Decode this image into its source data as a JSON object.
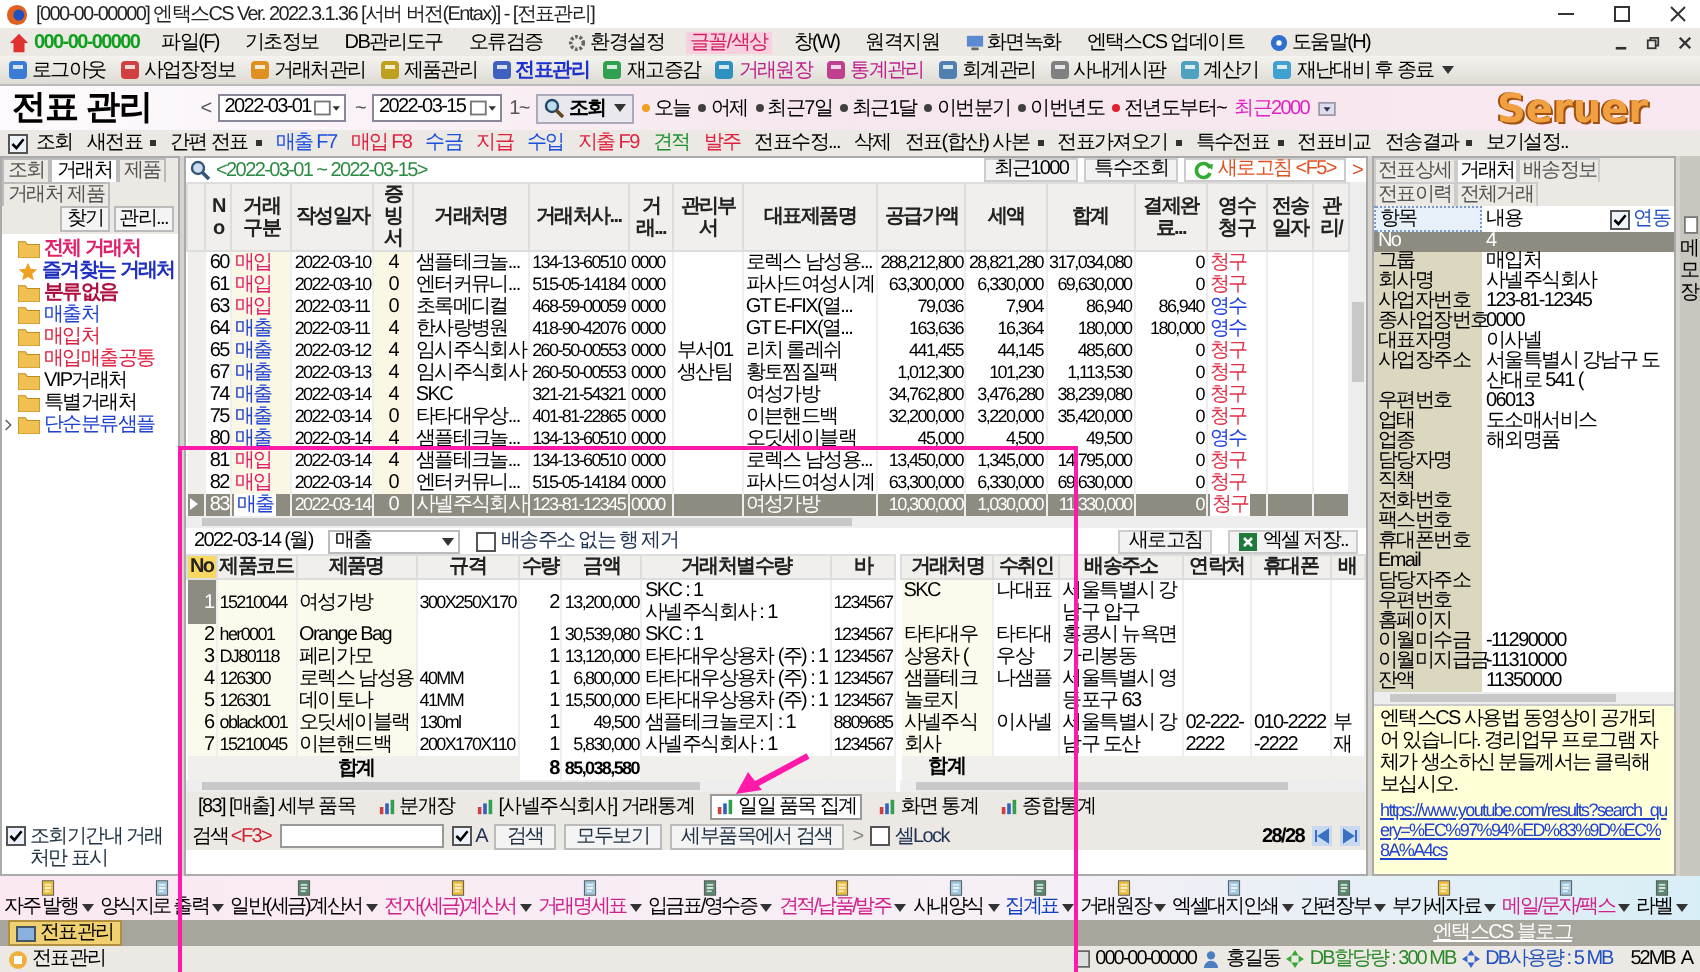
{
  "window": {
    "title": "[000-00-00000] 엔택스CS Ver. 2022.3.1.36 [서버 버전(Entax)] - [전표관리]"
  },
  "menu": {
    "company": "000-00-00000",
    "items": [
      {
        "label": "파일(F)",
        "highlighted": false
      },
      {
        "label": "기초정보",
        "highlighted": false
      },
      {
        "label": "DB관리도구",
        "highlighted": false
      },
      {
        "label": "오류검증",
        "highlighted": false
      },
      {
        "label": "환경설정",
        "highlighted": false
      },
      {
        "label": "글꼴/색상",
        "highlighted": true
      },
      {
        "label": "창(W)",
        "highlighted": false
      },
      {
        "label": "원격지원",
        "highlighted": false
      },
      {
        "label": "화면녹화",
        "highlighted": false
      },
      {
        "label": "엔택스CS 업데이트",
        "highlighted": false
      },
      {
        "label": "도움말(H)",
        "highlighted": false
      }
    ]
  },
  "toolbar": [
    {
      "label": "로그아웃",
      "color": "#000000",
      "selected": false,
      "dropdown": false
    },
    {
      "label": "사업장정보",
      "color": "#000000",
      "selected": false,
      "dropdown": false
    },
    {
      "label": "거래처관리",
      "color": "#000000",
      "selected": false,
      "dropdown": false
    },
    {
      "label": "제품관리",
      "color": "#000000",
      "selected": false,
      "dropdown": false
    },
    {
      "label": "전표관리",
      "color": "#1a2fd0",
      "selected": true,
      "dropdown": false
    },
    {
      "label": "재고증감",
      "color": "#000000",
      "selected": false,
      "dropdown": false
    },
    {
      "label": "거래원장",
      "color": "#c0208c",
      "selected": false,
      "dropdown": false
    },
    {
      "label": "통계관리",
      "color": "#c0208c",
      "selected": false,
      "dropdown": false
    },
    {
      "label": "회계관리",
      "color": "#000000",
      "selected": false,
      "dropdown": false
    },
    {
      "label": "사내게시판",
      "color": "#000000",
      "selected": false,
      "dropdown": false
    },
    {
      "label": "계산기",
      "color": "#000000",
      "selected": false,
      "dropdown": false
    },
    {
      "label": "재난대비 후 종료",
      "color": "#000000",
      "selected": false,
      "dropdown": true
    }
  ],
  "header": {
    "title": "전표 관리",
    "prev": "<",
    "date_from": "2022-03-01",
    "separator": "~",
    "date_to": "2022-03-15",
    "count": "1~",
    "search": "조회",
    "quick_ranges": [
      {
        "label": "오늘",
        "kind": "bullet",
        "color": "#f0a020"
      },
      {
        "label": "어제",
        "kind": "bullet",
        "color": "#404040"
      },
      {
        "label": "최근7일",
        "kind": "bullet",
        "color": "#404040"
      },
      {
        "label": "최근1달",
        "kind": "bullet",
        "color": "#404040"
      },
      {
        "label": "이번분기",
        "kind": "bullet",
        "color": "#404040"
      },
      {
        "label": "이번년도",
        "kind": "bullet",
        "color": "#404040"
      },
      {
        "label": "전년도부터~",
        "kind": "bullet",
        "color": "#e02030"
      },
      {
        "label": "최근2000",
        "kind": "highlight",
        "color": "#e020c0"
      }
    ],
    "logo": "Seruer"
  },
  "actions": {
    "view": {
      "label": "조회",
      "checked": true
    },
    "items": [
      {
        "label": "새전표",
        "color": "#000000",
        "dropdown": true
      },
      {
        "label": "간편 전표",
        "color": "#000000",
        "dropdown": true
      },
      {
        "label": "매출 F7",
        "color": "#1a4fe0",
        "dropdown": false
      },
      {
        "label": "매입 F8",
        "color": "#e02040",
        "dropdown": false
      },
      {
        "label": "수금",
        "color": "#1a4fe0",
        "dropdown": false
      },
      {
        "label": "지급",
        "color": "#e02040",
        "dropdown": false
      },
      {
        "label": "수입",
        "color": "#1a4fe0",
        "dropdown": false
      },
      {
        "label": "지출 F9",
        "color": "#e02040",
        "dropdown": false
      },
      {
        "label": "견적",
        "color": "#1a9030",
        "dropdown": false
      },
      {
        "label": "발주",
        "color": "#e02040",
        "dropdown": false
      },
      {
        "label": "전표수정...",
        "color": "#000000",
        "dropdown": false
      },
      {
        "label": "삭제",
        "color": "#000000",
        "dropdown": false
      },
      {
        "label": "전표(합산) 사본",
        "color": "#000000",
        "dropdown": true
      },
      {
        "label": "전표가져오기",
        "color": "#000000",
        "dropdown": true
      },
      {
        "label": "특수전표",
        "color": "#000000",
        "dropdown": true
      },
      {
        "label": "전표비교",
        "color": "#000000",
        "dropdown": false
      },
      {
        "label": "전송결과",
        "color": "#000000",
        "dropdown": true
      },
      {
        "label": "보기설정..",
        "color": "#000000",
        "dropdown": false
      }
    ]
  },
  "sidebar": {
    "tabs": [
      {
        "label": "조회",
        "selected": false
      },
      {
        "label": "거래처",
        "selected": true
      },
      {
        "label": "제품",
        "selected": false
      },
      {
        "label": "거래처 제품",
        "selected": false
      }
    ],
    "buttons": [
      "찾기",
      "관리..."
    ],
    "tree": [
      {
        "label": "전체 거래처",
        "color": "#e0206a",
        "bold": true,
        "expandable": false
      },
      {
        "label": "즐겨찾는 거래처",
        "color": "#2030c0",
        "bold": true,
        "expandable": false
      },
      {
        "label": "분류없음",
        "color": "#b01040",
        "bold": true,
        "expandable": false
      },
      {
        "label": "매출처",
        "color": "#2040d0",
        "bold": false,
        "expandable": false
      },
      {
        "label": "매입처",
        "color": "#e02040",
        "bold": false,
        "expandable": false
      },
      {
        "label": "매입매출공통",
        "color": "#e02040",
        "bold": false,
        "expandable": false
      },
      {
        "label": "VIP거래처",
        "color": "#000000",
        "bold": false,
        "expandable": false
      },
      {
        "label": "특별거래처",
        "color": "#000000",
        "bold": false,
        "expandable": false
      },
      {
        "label": "단순분류샘플",
        "color": "#2040d0",
        "bold": false,
        "expandable": true
      }
    ],
    "filter": {
      "label": "조회기간내 거래처만 표시",
      "checked": true
    }
  },
  "grid": {
    "filter": "<2022-03-01 ~ 2022-03-15>",
    "buttons": [
      "최근1000",
      "특수조회"
    ],
    "refresh": "새로고침 <F5>",
    "more": ">",
    "columns": [
      "No",
      "거래구분",
      "작성일자",
      "증빙서",
      "거래처명",
      "거래처사...",
      "거래...",
      "관리부서",
      "대표제품명",
      "공급가액",
      "세액",
      "합계",
      "결제완료...",
      "영수청구",
      "전송일자",
      "관리/"
    ],
    "rows": [
      {
        "no": "60",
        "type": {
          "text": "매입",
          "color": "#e0206a"
        },
        "date": "2022-03-10",
        "evidence": "4",
        "partner": "샘플테크놀...",
        "biz_no": "134-13-60510",
        "code": "0000",
        "product": "로렉스 남성용...",
        "supply": "288,212,800",
        "tax": "28,821,280",
        "total": "317,034,080",
        "paid": "0",
        "claim": {
          "text": "청구",
          "color": "#e0304a"
        },
        "selected": false
      },
      {
        "no": "61",
        "type": {
          "text": "매입",
          "color": "#e0206a"
        },
        "date": "2022-03-10",
        "evidence": "0",
        "partner": "엔터커뮤니...",
        "biz_no": "515-05-14184",
        "code": "0000",
        "product": "파사드여성시계",
        "supply": "63,300,000",
        "tax": "6,330,000",
        "total": "69,630,000",
        "paid": "0",
        "claim": {
          "text": "청구",
          "color": "#e0304a"
        },
        "selected": false
      },
      {
        "no": "63",
        "type": {
          "text": "매입",
          "color": "#e0206a"
        },
        "date": "2022-03-11",
        "evidence": "0",
        "partner": "초록메디컬",
        "biz_no": "468-59-00059",
        "code": "0000",
        "product": "GT E-FIX(열...",
        "supply": "79,036",
        "tax": "7,904",
        "total": "86,940",
        "paid": "86,940",
        "claim": {
          "text": "영수",
          "color": "#2040e0"
        },
        "selected": false
      },
      {
        "no": "64",
        "type": {
          "text": "매출",
          "color": "#2040d0"
        },
        "date": "2022-03-11",
        "evidence": "4",
        "partner": "한사랑병원",
        "biz_no": "418-90-42076",
        "code": "0000",
        "product": "GT E-FIX(열...",
        "supply": "163,636",
        "tax": "16,364",
        "total": "180,000",
        "paid": "180,000",
        "claim": {
          "text": "영수",
          "color": "#2040e0"
        },
        "selected": false
      },
      {
        "no": "65",
        "type": {
          "text": "매출",
          "color": "#2040d0"
        },
        "date": "2022-03-12",
        "evidence": "4",
        "partner": "임시주식회사",
        "biz_no": "260-50-00553",
        "code": "0000",
        "dept": "부서01",
        "product": "리치 롤레쉬",
        "supply": "441,455",
        "tax": "44,145",
        "total": "485,600",
        "paid": "0",
        "claim": {
          "text": "청구",
          "color": "#e0304a"
        },
        "selected": false
      },
      {
        "no": "67",
        "type": {
          "text": "매출",
          "color": "#2040d0"
        },
        "date": "2022-03-13",
        "evidence": "4",
        "partner": "임시주식회사",
        "biz_no": "260-50-00553",
        "code": "0000",
        "dept": "생산팀",
        "product": "황토찜질팩",
        "supply": "1,012,300",
        "tax": "101,230",
        "total": "1,113,530",
        "paid": "0",
        "claim": {
          "text": "청구",
          "color": "#e0304a"
        },
        "selected": false
      },
      {
        "no": "74",
        "type": {
          "text": "매출",
          "color": "#2040d0"
        },
        "date": "2022-03-14",
        "evidence": "4",
        "partner": "SKC",
        "biz_no": "321-21-54321",
        "code": "0000",
        "product": "여성가방",
        "supply": "34,762,800",
        "tax": "3,476,280",
        "total": "38,239,080",
        "paid": "0",
        "claim": {
          "text": "청구",
          "color": "#e0304a"
        },
        "selected": false
      },
      {
        "no": "75",
        "type": {
          "text": "매출",
          "color": "#2040d0"
        },
        "date": "2022-03-14",
        "evidence": "0",
        "partner": "타타대우상...",
        "biz_no": "401-81-22865",
        "code": "0000",
        "product": "이븐핸드백",
        "supply": "32,200,000",
        "tax": "3,220,000",
        "total": "35,420,000",
        "paid": "0",
        "claim": {
          "text": "청구",
          "color": "#e0304a"
        },
        "selected": false
      },
      {
        "no": "80",
        "type": {
          "text": "매출",
          "color": "#2040d0"
        },
        "date": "2022-03-14",
        "evidence": "4",
        "partner": "샘플테크놀...",
        "biz_no": "134-13-60510",
        "code": "0000",
        "product": "오딧세이블랙",
        "supply": "45,000",
        "tax": "4,500",
        "total": "49,500",
        "paid": "0",
        "claim": {
          "text": "영수",
          "color": "#2040e0"
        },
        "selected": false
      },
      {
        "no": "81",
        "type": {
          "text": "매입",
          "color": "#e0206a"
        },
        "date": "2022-03-14",
        "evidence": "4",
        "partner": "샘플테크놀...",
        "biz_no": "134-13-60510",
        "code": "0000",
        "product": "로렉스 남성용...",
        "supply": "13,450,000",
        "tax": "1,345,000",
        "total": "14,795,000",
        "paid": "0",
        "claim": {
          "text": "청구",
          "color": "#e0304a"
        },
        "selected": false
      },
      {
        "no": "82",
        "type": {
          "text": "매입",
          "color": "#e0206a"
        },
        "date": "2022-03-14",
        "evidence": "0",
        "partner": "엔터커뮤니...",
        "biz_no": "515-05-14184",
        "code": "0000",
        "product": "파사드여성시계",
        "supply": "63,300,000",
        "tax": "6,330,000",
        "total": "69,630,000",
        "paid": "0",
        "claim": {
          "text": "청구",
          "color": "#e0304a"
        },
        "selected": false
      },
      {
        "no": "83",
        "type": {
          "text": "매출",
          "color": "#2040d0"
        },
        "date": "2022-03-14",
        "evidence": "0",
        "partner": "사넬주식회사",
        "biz_no": "123-81-12345",
        "code": "0000",
        "product": "여성가방",
        "supply": "10,300,000",
        "tax": "1,030,000",
        "total": "11,330,000",
        "paid": "0",
        "claim": {
          "text": "청구",
          "color": "#e0304a"
        },
        "selected": true
      }
    ]
  },
  "detail": {
    "date": "2022-03-14 (월)",
    "type_select": "매출",
    "remove_empty": {
      "label": "배송주소 없는 행 제거",
      "checked": false
    },
    "refresh": "새로고침",
    "excel": "엑셀 저장..",
    "items": {
      "columns": [
        "No",
        "제품코드",
        "제품명",
        "규격",
        "수량",
        "금액",
        "거래처별수량",
        "바"
      ],
      "rows": [
        {
          "no": "1",
          "code": "15210044",
          "name": "여성가방",
          "spec": "300X250X170",
          "qty": "2",
          "amount": "13,200,000",
          "partner_qty": [
            "SKC : 1",
            "사넬주식회사 : 1"
          ],
          "barcode": "1234567",
          "selected": true
        },
        {
          "no": "2",
          "code": "her0001",
          "name": "Orange Bag",
          "qty": "1",
          "amount": "30,539,080",
          "partner_qty": [
            "SKC : 1"
          ],
          "barcode": "1234567",
          "selected": false
        },
        {
          "no": "3",
          "code": "DJ80118",
          "name": "페리가모",
          "qty": "1",
          "amount": "13,120,000",
          "partner_qty": [
            "타타대우상용차 (주) : 1"
          ],
          "barcode": "1234567",
          "selected": false
        },
        {
          "no": "4",
          "code": "126300",
          "name": "로렉스 남성용",
          "spec": "40MM",
          "qty": "1",
          "amount": "6,800,000",
          "partner_qty": [
            "타타대우상용차 (주) : 1"
          ],
          "barcode": "1234567",
          "selected": false
        },
        {
          "no": "5",
          "code": "126301",
          "name": "데이토나",
          "spec": "41MM",
          "qty": "1",
          "amount": "15,500,000",
          "partner_qty": [
            "타타대우상용차 (주) : 1"
          ],
          "barcode": "1234567",
          "selected": false
        },
        {
          "no": "6",
          "code": "oblack001",
          "name": "오딧세이블랙",
          "spec": "130ml",
          "qty": "1",
          "amount": "49,500",
          "partner_qty": [
            "샘플테크놀로지 : 1"
          ],
          "barcode": "8809685",
          "selected": false
        },
        {
          "no": "7",
          "code": "15210045",
          "name": "이븐핸드백",
          "spec": "200X170X110",
          "qty": "1",
          "amount": "5,830,000",
          "partner_qty": [
            "사넬주식회사 : 1"
          ],
          "barcode": "1234567",
          "selected": false
        }
      ],
      "total": {
        "label": "합계",
        "qty": "8",
        "amount": "85,038,580"
      }
    },
    "shipping": {
      "columns": [
        "거래처명",
        "수취인",
        "배송주소",
        "연락처",
        "휴대폰",
        "배"
      ],
      "rows": [
        {
          "partner": "SKC",
          "receiver": "나대표",
          "address": "서울특별시 강남구 압구"
        },
        {
          "partner": "타타대우상용차 (",
          "receiver": "타타대우상",
          "address": "홍콩시 뉴욕면 가리봉동"
        },
        {
          "partner": "샘플테크놀로지",
          "receiver": "나샘플",
          "address": "서울특별시 영등포구 63"
        },
        {
          "partner": "사넬주식회사",
          "receiver": "이사넬",
          "address": "서울특별시 강남구 도산",
          "phone": "02-222-2222",
          "mobile": "010-2222-2222",
          "note": "부재"
        }
      ],
      "total": {
        "label": "합계"
      }
    }
  },
  "detail_tabs": [
    {
      "label": "[83] [매출] 세부 품목",
      "selected": false
    },
    {
      "label": "분개장",
      "selected": false
    },
    {
      "label": "[사넬주식회사] 거래통계",
      "selected": false
    },
    {
      "label": "일일 품목 집계",
      "selected": true
    },
    {
      "label": "화면 통계",
      "selected": false
    },
    {
      "label": "종합통계",
      "selected": false
    }
  ],
  "search": {
    "label": "검색",
    "key": "<F3>",
    "a_check": {
      "label": "A",
      "checked": true
    },
    "buttons": [
      "검색",
      "모두보기",
      "세부품목에서 검색"
    ],
    "arrow": ">",
    "lock": {
      "label": "셀Lock",
      "checked": false
    },
    "page": "28/28"
  },
  "right_panel": {
    "tabs": [
      {
        "label": "전표상세",
        "selected": false
      },
      {
        "label": "거래처",
        "selected": true
      },
      {
        "label": "배송정보",
        "selected": false
      },
      {
        "label": "전표이력",
        "selected": false
      },
      {
        "label": "전체거래",
        "selected": false
      }
    ],
    "header": {
      "key": "항목",
      "value": "내용",
      "sync": {
        "label": "연동",
        "checked": true
      }
    },
    "properties": [
      {
        "label": "No",
        "value": "4",
        "selected": true
      },
      {
        "label": "그룹",
        "value": "매입처",
        "selected": false
      },
      {
        "label": "회사명",
        "value": "사넬주식회사",
        "selected": false
      },
      {
        "label": "사업자번호",
        "value": "123-81-12345",
        "selected": false
      },
      {
        "label": "종사업장번호",
        "value": "0000",
        "selected": false
      },
      {
        "label": "대표자명",
        "value": "이사넬",
        "selected": false
      },
      {
        "label": "사업장주소",
        "value": "서울특별시 강남구 도산대로 541 (",
        "selected": false
      },
      {
        "label": "우편번호",
        "value": "06013",
        "selected": false
      },
      {
        "label": "업태",
        "value": "도소매서비스",
        "selected": false
      },
      {
        "label": "업종",
        "value": "해외명품",
        "selected": false
      },
      {
        "label": "담당자명",
        "selected": false
      },
      {
        "label": "직책",
        "selected": false
      },
      {
        "label": "전화번호",
        "selected": false
      },
      {
        "label": "팩스번호",
        "selected": false
      },
      {
        "label": "휴대폰번호",
        "selected": false
      },
      {
        "label": "Email",
        "selected": false
      },
      {
        "label": "담당자주소",
        "selected": false
      },
      {
        "label": "우편번호",
        "selected": false
      },
      {
        "label": "홈페이지",
        "selected": false
      },
      {
        "label": "이월미수금",
        "value": "-11290000",
        "selected": false
      },
      {
        "label": "이월미지급금",
        "value": "-11310000",
        "selected": false
      },
      {
        "label": "잔액",
        "value": "11350000",
        "selected": false
      }
    ],
    "notice": {
      "text": "엔택스CS 사용법 동영상이 공개되어 있습니다. 경리업무 프로그램 자체가 생소하신 분들께서는 클릭해 보십시오.",
      "link": "https://www.youtube.com/results?search_query=%EC%97%94%ED%83%9D%EC%8A%A4cs"
    }
  },
  "side_strip": {
    "label": "메모장"
  },
  "bottom_bar": [
    {
      "label": "자주 발행",
      "color": "#000000"
    },
    {
      "label": "양식지로 출력",
      "color": "#000000"
    },
    {
      "label": "일반(세금)계산서",
      "color": "#000000"
    },
    {
      "label": "전자(세금)계산서",
      "color": "#d0208c"
    },
    {
      "label": "거래명세표",
      "color": "#d0208c"
    },
    {
      "label": "입금표/영수증",
      "color": "#000000"
    },
    {
      "label": "견적/납품/발주",
      "color": "#d0208c"
    },
    {
      "label": "사내양식",
      "color": "#000000"
    },
    {
      "label": "집계표",
      "color": "#1040c0"
    },
    {
      "label": "거래원장",
      "color": "#000000"
    },
    {
      "label": "엑셀대지인쇄",
      "color": "#000000"
    },
    {
      "label": "간편장부",
      "color": "#000000"
    },
    {
      "label": "부가세자료",
      "color": "#000000"
    },
    {
      "label": "메일/문자/팩스",
      "color": "#d0208c"
    },
    {
      "label": "라벨",
      "color": "#000000"
    }
  ],
  "blog_link": "엔택스CS 블로그",
  "window_tabs": [
    {
      "label": "전표관리",
      "selected": true
    }
  ],
  "status": {
    "app": "전표관리",
    "company": "000-00-00000",
    "user": "홍길동",
    "db_quota": "DB할당량 : 300 MB",
    "db_used": "DB사용량 : 5 MB",
    "memory": "52MB",
    "mode": "A"
  }
}
